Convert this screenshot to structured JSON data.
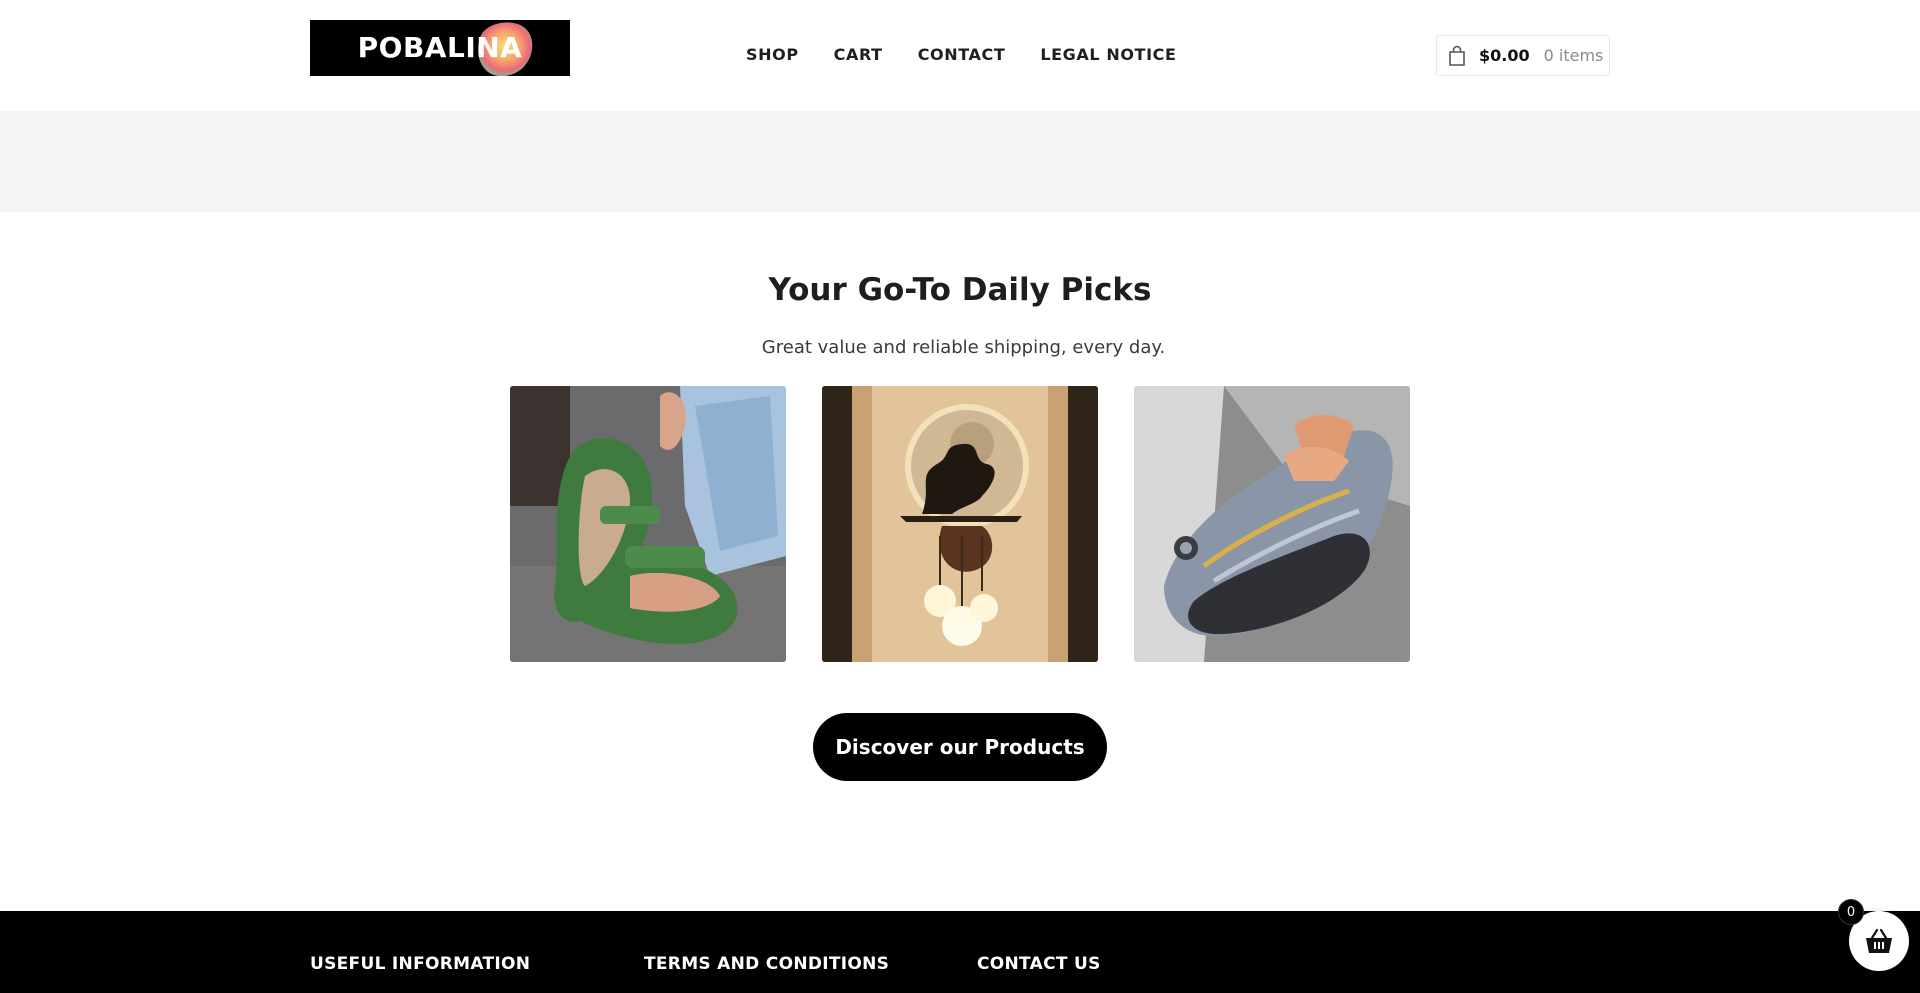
{
  "header": {
    "logo_text": "POBALINA",
    "nav": {
      "shop": "SHOP",
      "cart": "CART",
      "contact": "CONTACT",
      "legal": "LEGAL NOTICE"
    },
    "cart_widget": {
      "icon": "shopping-bag-icon",
      "amount": "$0.00",
      "items": "0 items"
    }
  },
  "picks": {
    "title": "Your Go-To Daily Picks",
    "subtitle": "Great value and reliable shipping, every day.",
    "cta_label": "Discover our Products"
  },
  "footer": {
    "col1": "USEFUL INFORMATION",
    "col2": "TERMS AND CONDITIONS",
    "col3": "CONTACT US"
  },
  "floating_cart": {
    "icon": "basket-icon",
    "count": "0"
  },
  "colors": {
    "band": "#f4f5f7",
    "footer": "#000000",
    "cta": "#000000"
  }
}
